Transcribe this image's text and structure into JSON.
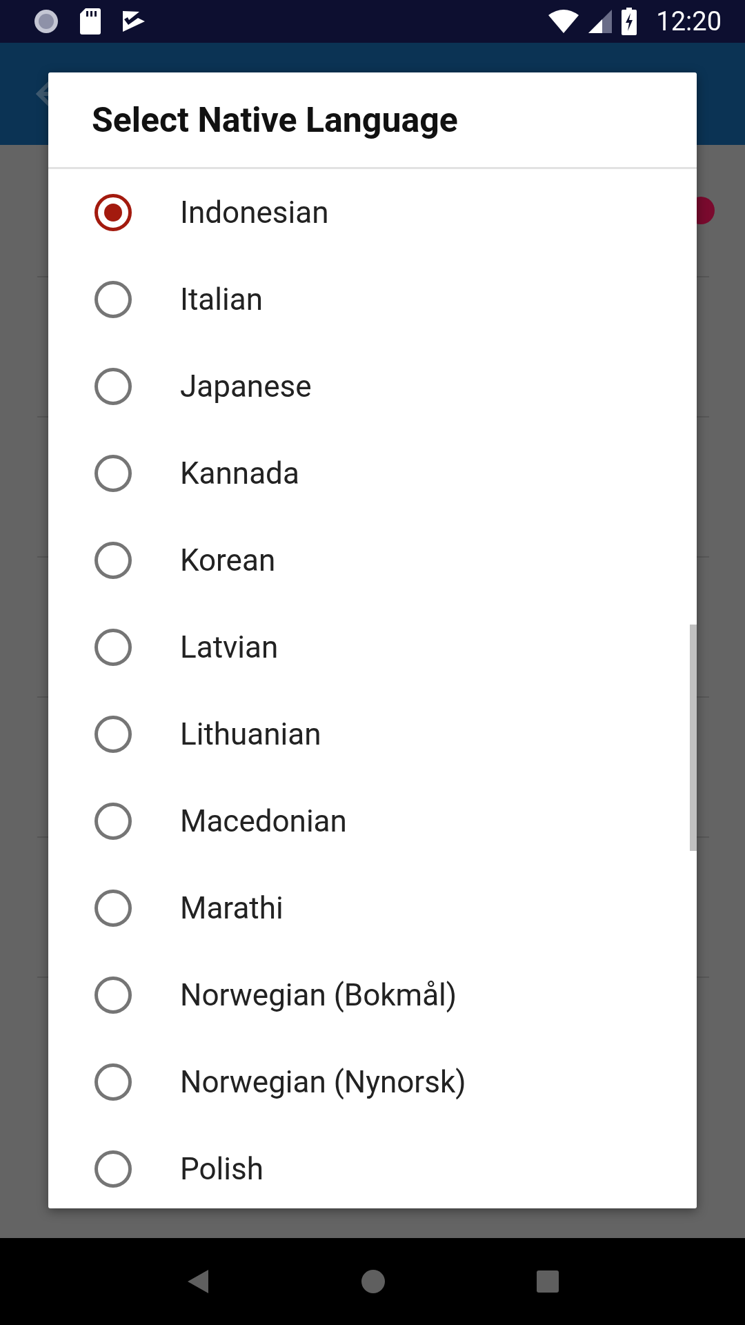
{
  "status_bar": {
    "time": "12:20"
  },
  "background": {
    "indicator": true
  },
  "dialog": {
    "title": "Select Native Language",
    "options": [
      {
        "label": "Indonesian",
        "selected": true
      },
      {
        "label": "Italian",
        "selected": false
      },
      {
        "label": "Japanese",
        "selected": false
      },
      {
        "label": "Kannada",
        "selected": false
      },
      {
        "label": "Korean",
        "selected": false
      },
      {
        "label": "Latvian",
        "selected": false
      },
      {
        "label": "Lithuanian",
        "selected": false
      },
      {
        "label": "Macedonian",
        "selected": false
      },
      {
        "label": "Marathi",
        "selected": false
      },
      {
        "label": "Norwegian (Bokmål)",
        "selected": false
      },
      {
        "label": "Norwegian (Nynorsk)",
        "selected": false
      },
      {
        "label": "Polish",
        "selected": false
      }
    ]
  }
}
